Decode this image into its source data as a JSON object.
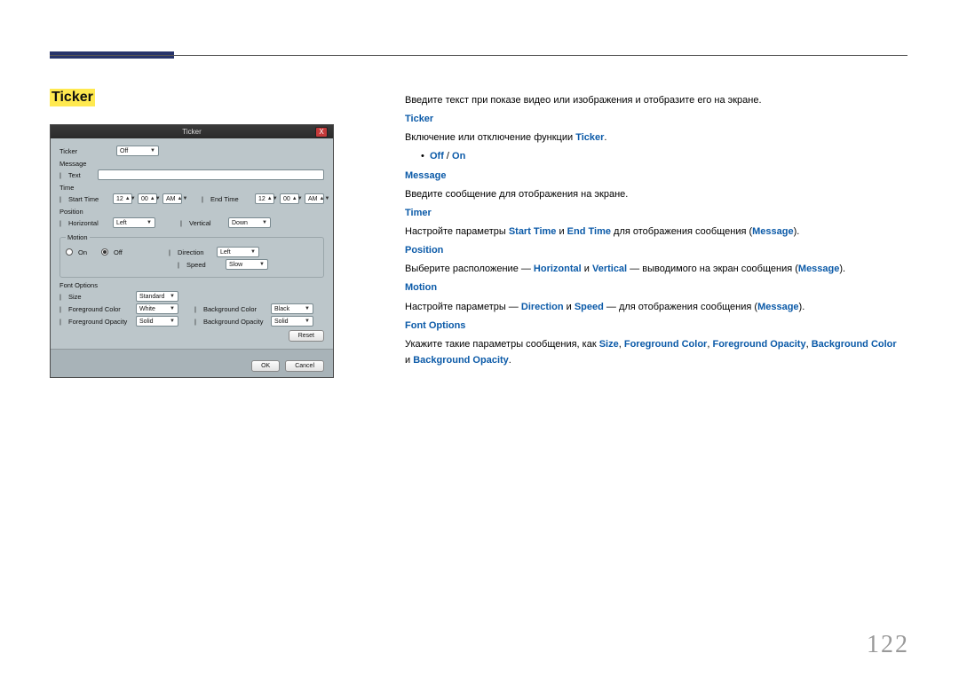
{
  "page_number": "122",
  "heading": "Ticker",
  "dialog": {
    "title": "Ticker",
    "close": "X",
    "rows": {
      "ticker_label": "Ticker",
      "ticker_value": "Off",
      "message_label": "Message",
      "text_label": "Text",
      "time_label": "Time",
      "start_time_label": "Start Time",
      "end_time_label": "End Time",
      "st_hour": "12",
      "st_min": "00",
      "st_ampm": "AM",
      "et_hour": "12",
      "et_min": "00",
      "et_ampm": "AM",
      "position_label": "Position",
      "horizontal_label": "Horizontal",
      "horizontal_value": "Left",
      "vertical_label": "Vertical",
      "vertical_value": "Down",
      "motion_label": "Motion",
      "on_label": "On",
      "off_label": "Off",
      "direction_label": "Direction",
      "direction_value": "Left",
      "speed_label": "Speed",
      "speed_value": "Slow",
      "font_options_label": "Font Options",
      "size_label": "Size",
      "size_value": "Standard",
      "fg_color_label": "Foreground Color",
      "fg_color_value": "White",
      "fg_opacity_label": "Foreground Opacity",
      "fg_opacity_value": "Solid",
      "bg_color_label": "Background Color",
      "bg_color_value": "Black",
      "bg_opacity_label": "Background Opacity",
      "bg_opacity_value": "Solid",
      "reset": "Reset",
      "ok": "OK",
      "cancel": "Cancel"
    }
  },
  "doc": {
    "intro": "Введите текст при показе видео или изображения и отобразите его на экране.",
    "ticker_h": "Ticker",
    "ticker_txt_a": "Включение или отключение функции ",
    "ticker_txt_b": "Ticker",
    "ticker_bullet_off": "Off",
    "ticker_bullet_sep": " / ",
    "ticker_bullet_on": "On",
    "message_h": "Message",
    "message_txt": "Введите сообщение для отображения на экране.",
    "timer_h": "Timer",
    "timer_txt_a": "Настройте параметры ",
    "timer_start": "Start Time",
    "timer_and": " и ",
    "timer_end": "End Time",
    "timer_txt_b": " для отображения сообщения (",
    "timer_msg": "Message",
    "timer_txt_c": ").",
    "position_h": "Position",
    "position_txt_a": "Выберите расположение — ",
    "position_h1": "Horizontal",
    "position_and": " и ",
    "position_v1": "Vertical",
    "position_txt_b": " — выводимого на экран сообщения (",
    "position_msg": "Message",
    "position_txt_c": ").",
    "motion_h": "Motion",
    "motion_txt_a": "Настройте параметры — ",
    "motion_dir": "Direction",
    "motion_and": " и ",
    "motion_spd": "Speed",
    "motion_txt_b": " — для отображения сообщения (",
    "motion_msg": "Message",
    "motion_txt_c": ").",
    "font_h": "Font Options",
    "font_txt_a": "Укажите такие параметры сообщения, как ",
    "font_size": "Size",
    "font_sep1": ", ",
    "font_fgc": "Foreground Color",
    "font_sep2": ", ",
    "font_fgo": "Foreground Opacity",
    "font_sep3": ", ",
    "font_bgc": "Background Color",
    "font_sep4": " и ",
    "font_bgo": "Background Opacity",
    "font_txt_end": "."
  }
}
